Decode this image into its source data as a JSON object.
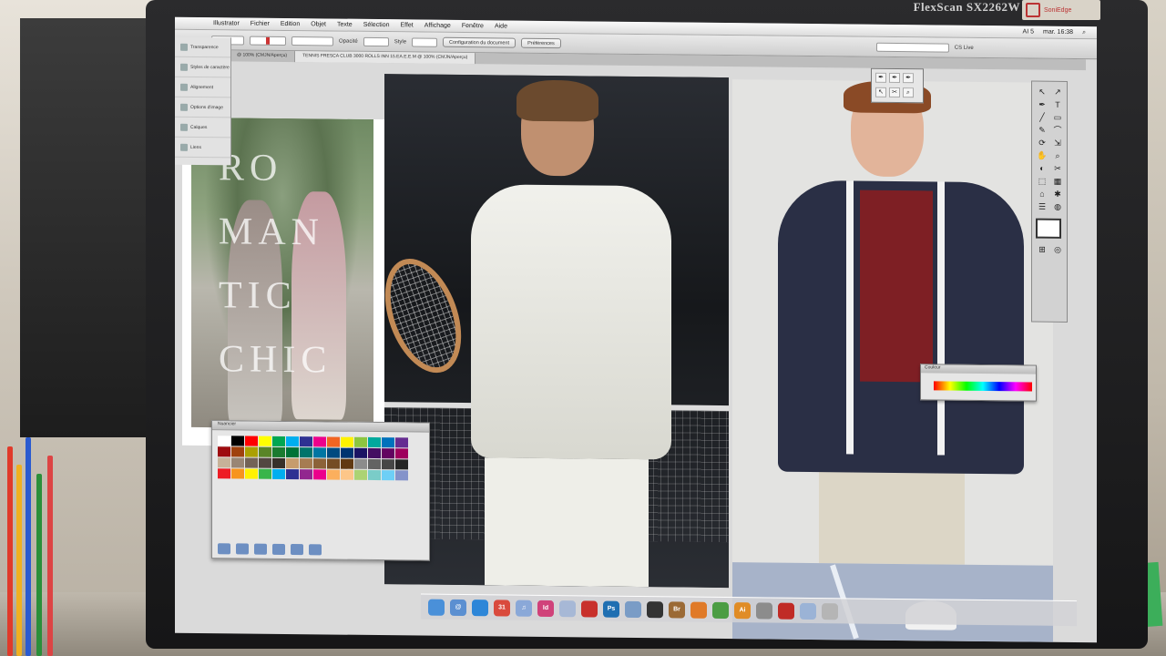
{
  "monitor": {
    "brand": "FlexScan SX2262W",
    "badge": "SoniEdge"
  },
  "menubar": {
    "app": "Illustrator",
    "items": [
      "Fichier",
      "Edition",
      "Objet",
      "Texte",
      "Sélection",
      "Effet",
      "Affichage",
      "Fenêtre",
      "Aide"
    ],
    "clock": "mar. 16:38",
    "status": "AI 5"
  },
  "controlbar": {
    "opacity_label": "Opacité",
    "style_label": "Style",
    "doc_settings": "Configuration du document",
    "preferences": "Préférences",
    "workspace": "CS Live"
  },
  "tabs": [
    "@ 100% (CMJN/Aperçu)",
    "TENNIS FRESCA CLUB 3000 ROLLS INN 15.EA.E.E.M @ 100% (CMJN/Aperçu)"
  ],
  "left_panel": {
    "items": [
      "Transparence",
      "Styles de caractère",
      "Alignement",
      "Options d'image",
      "Calques",
      "Liens"
    ]
  },
  "artwork": {
    "lettering": [
      "RO",
      "MAN",
      "TIC",
      "CHIC"
    ]
  },
  "swatches_panel": {
    "title": "Nuancier",
    "colors": [
      "#ffffff",
      "#000000",
      "#ff0000",
      "#ffff00",
      "#00a651",
      "#00aeef",
      "#2e3192",
      "#ec008c",
      "#f26522",
      "#fff200",
      "#8dc63f",
      "#00a99d",
      "#0072bc",
      "#662d91",
      "#9e0b0f",
      "#a0410d",
      "#aba000",
      "#598527",
      "#1a7b30",
      "#007236",
      "#00746b",
      "#0076a3",
      "#004a80",
      "#003471",
      "#1b1464",
      "#440e62",
      "#630460",
      "#9e005d",
      "#c7b299",
      "#998675",
      "#736357",
      "#534741",
      "#37302a",
      "#c69c6d",
      "#a67c52",
      "#8c6239",
      "#754c24",
      "#603913",
      "#8c8c8c",
      "#636363",
      "#464646",
      "#252525",
      "#ed1c24",
      "#f7941d",
      "#fff200",
      "#39b54a",
      "#00aeef",
      "#2e3192",
      "#92278f",
      "#ec008c",
      "#fbaf5d",
      "#fdc689",
      "#acd373",
      "#7accc8",
      "#6dcff6",
      "#8493ca"
    ]
  },
  "color_panel": {
    "title": "Couleur"
  },
  "dock": {
    "apps": [
      {
        "name": "finder",
        "label": "",
        "color": "#4a90d9"
      },
      {
        "name": "mail",
        "label": "@",
        "color": "#5b8fd1"
      },
      {
        "name": "safari",
        "label": "",
        "color": "#2d86d8"
      },
      {
        "name": "calendar",
        "label": "31",
        "color": "#d94a3d"
      },
      {
        "name": "itunes",
        "label": "♫",
        "color": "#8aa8d8"
      },
      {
        "name": "indesign",
        "label": "Id",
        "color": "#d0427a"
      },
      {
        "name": "folder",
        "label": "",
        "color": "#a7b8d6"
      },
      {
        "name": "acrobat",
        "label": "",
        "color": "#c8302c"
      },
      {
        "name": "photoshop",
        "label": "Ps",
        "color": "#1f6fb2"
      },
      {
        "name": "preview",
        "label": "",
        "color": "#7a9cc6"
      },
      {
        "name": "terminal",
        "label": "",
        "color": "#333333"
      },
      {
        "name": "bridge",
        "label": "Br",
        "color": "#9b6a35"
      },
      {
        "name": "firefox",
        "label": "",
        "color": "#e07a28"
      },
      {
        "name": "chrome",
        "label": "",
        "color": "#4b9d44"
      },
      {
        "name": "illustrator",
        "label": "Ai",
        "color": "#e08c26"
      },
      {
        "name": "preferences",
        "label": "",
        "color": "#8c8c8c"
      },
      {
        "name": "reader",
        "label": "",
        "color": "#c02b26"
      },
      {
        "name": "downloads",
        "label": "",
        "color": "#9bb3d6"
      },
      {
        "name": "trash",
        "label": "",
        "color": "#b5b5b5"
      }
    ]
  },
  "tools": [
    "↖",
    "↗",
    "✒",
    "T",
    "╱",
    "▭",
    "✎",
    "⌒",
    "⟳",
    "⇲",
    "✋",
    "⌕",
    "◐",
    "✂",
    "⬚",
    "▦",
    "⌂",
    "✱",
    "☰",
    "◍",
    "⊞",
    "◎"
  ],
  "popup_tools": [
    "✒",
    "✒",
    "✒",
    "↖",
    "✂",
    "⌕"
  ]
}
